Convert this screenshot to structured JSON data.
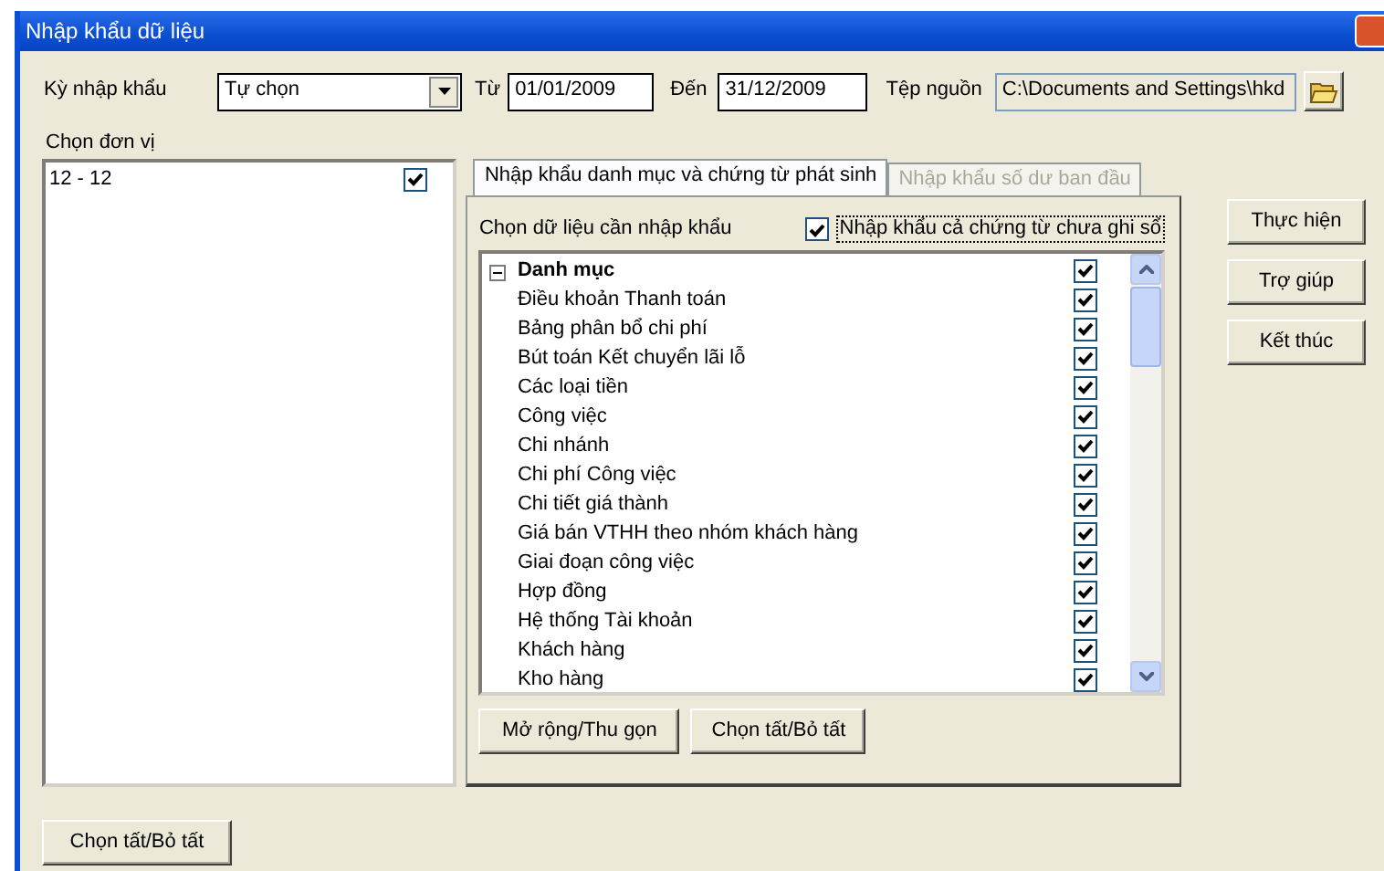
{
  "window": {
    "title": "Nhập khẩu dữ liệu"
  },
  "period": {
    "label": "Kỳ nhập khẩu",
    "value": "Tự chọn"
  },
  "from": {
    "label": "Từ",
    "value": "01/01/2009"
  },
  "to": {
    "label": "Đến",
    "value": "31/12/2009"
  },
  "source": {
    "label": "Tệp nguồn",
    "value": "C:\\Documents and Settings\\hkd"
  },
  "units": {
    "label": "Chọn đơn vị",
    "items": [
      {
        "label": "12 - 12",
        "checked": true
      }
    ]
  },
  "tabs": [
    {
      "label": "Nhập khẩu danh mục và chứng từ phát sinh",
      "selected": true,
      "disabled": false
    },
    {
      "label": "Nhập khẩu số dư ban đầu",
      "selected": false,
      "disabled": true
    }
  ],
  "data_select": {
    "label": "Chọn dữ liệu cần nhập khẩu",
    "include_unposted": {
      "label": "Nhập khẩu cả chứng từ chưa ghi sổ",
      "checked": true
    }
  },
  "tree": [
    {
      "label": "Danh mục",
      "expanded": true,
      "checked": true,
      "children": [
        {
          "label": "Điều khoản Thanh toán",
          "checked": true
        },
        {
          "label": "Bảng phân bổ chi phí",
          "checked": true
        },
        {
          "label": "Bút toán Kết chuyển lãi lỗ",
          "checked": true
        },
        {
          "label": "Các loại tiền",
          "checked": true
        },
        {
          "label": "Công việc",
          "checked": true
        },
        {
          "label": "Chi nhánh",
          "checked": true
        },
        {
          "label": "Chi phí Công việc",
          "checked": true
        },
        {
          "label": "Chi tiết giá thành",
          "checked": true
        },
        {
          "label": "Giá bán VTHH theo nhóm khách hàng",
          "checked": true
        },
        {
          "label": "Giai đoạn công việc",
          "checked": true
        },
        {
          "label": "Hợp đồng",
          "checked": true
        },
        {
          "label": "Hệ thống Tài khoản",
          "checked": true
        },
        {
          "label": "Khách hàng",
          "checked": true
        },
        {
          "label": "Kho hàng",
          "checked": true
        }
      ]
    }
  ],
  "tree_buttons": [
    "Mở rộng/Thu gọn",
    "Chọn tất/Bỏ tất"
  ],
  "action_buttons": [
    "Thực hiện",
    "Trợ giúp",
    "Kết thúc"
  ],
  "bottom_button": "Chọn tất/Bỏ tất"
}
